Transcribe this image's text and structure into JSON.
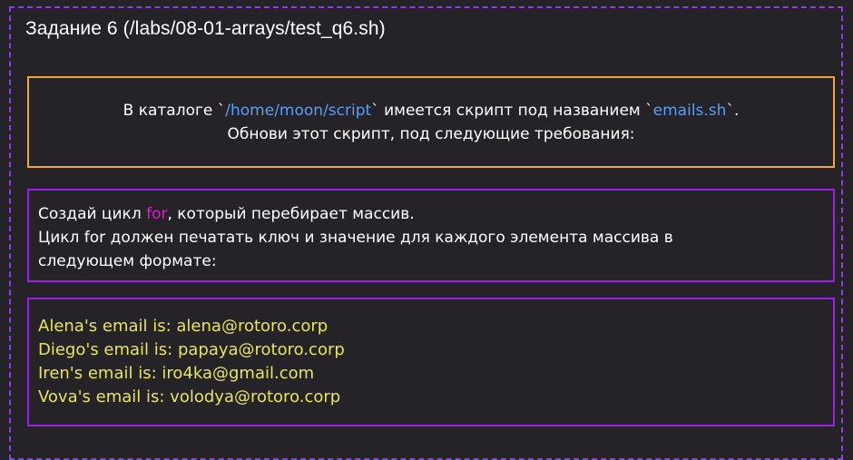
{
  "header": {
    "title": "Задание 6 (/labs/08-01-arrays/test_q6.sh)"
  },
  "intro": {
    "line1_part1": "В каталоге `",
    "line1_path": "/home/moon/script",
    "line1_part2": "` имеется скрипт под названием `",
    "line1_file": "emails.sh",
    "line1_part3": "`.",
    "line2": "Обнови этот скрипт, под следующие требования:"
  },
  "task": {
    "line1_part1": "Создай цикл ",
    "line1_keyword": "for",
    "line1_part2": ", который перебирает массив.",
    "line2": "Цикл for должен печатать ключ и значение для каждого элемента массива в",
    "line3": "следующем формате:"
  },
  "output": {
    "lines": [
      "Alena's email is: alena@rotoro.corp",
      "Diego's email is: papaya@rotoro.corp",
      "Iren's email is: iro4ka@gmail.com",
      "Vova's email is: volodya@rotoro.corp"
    ]
  },
  "colors": {
    "background": "#252228",
    "frame_border": "#8a3fe8",
    "intro_border": "#f0a53a",
    "box_border": "#9b1fe8",
    "path_text": "#5a9ff0",
    "keyword_text": "#e01ad6",
    "output_text": "#e6e65a"
  }
}
